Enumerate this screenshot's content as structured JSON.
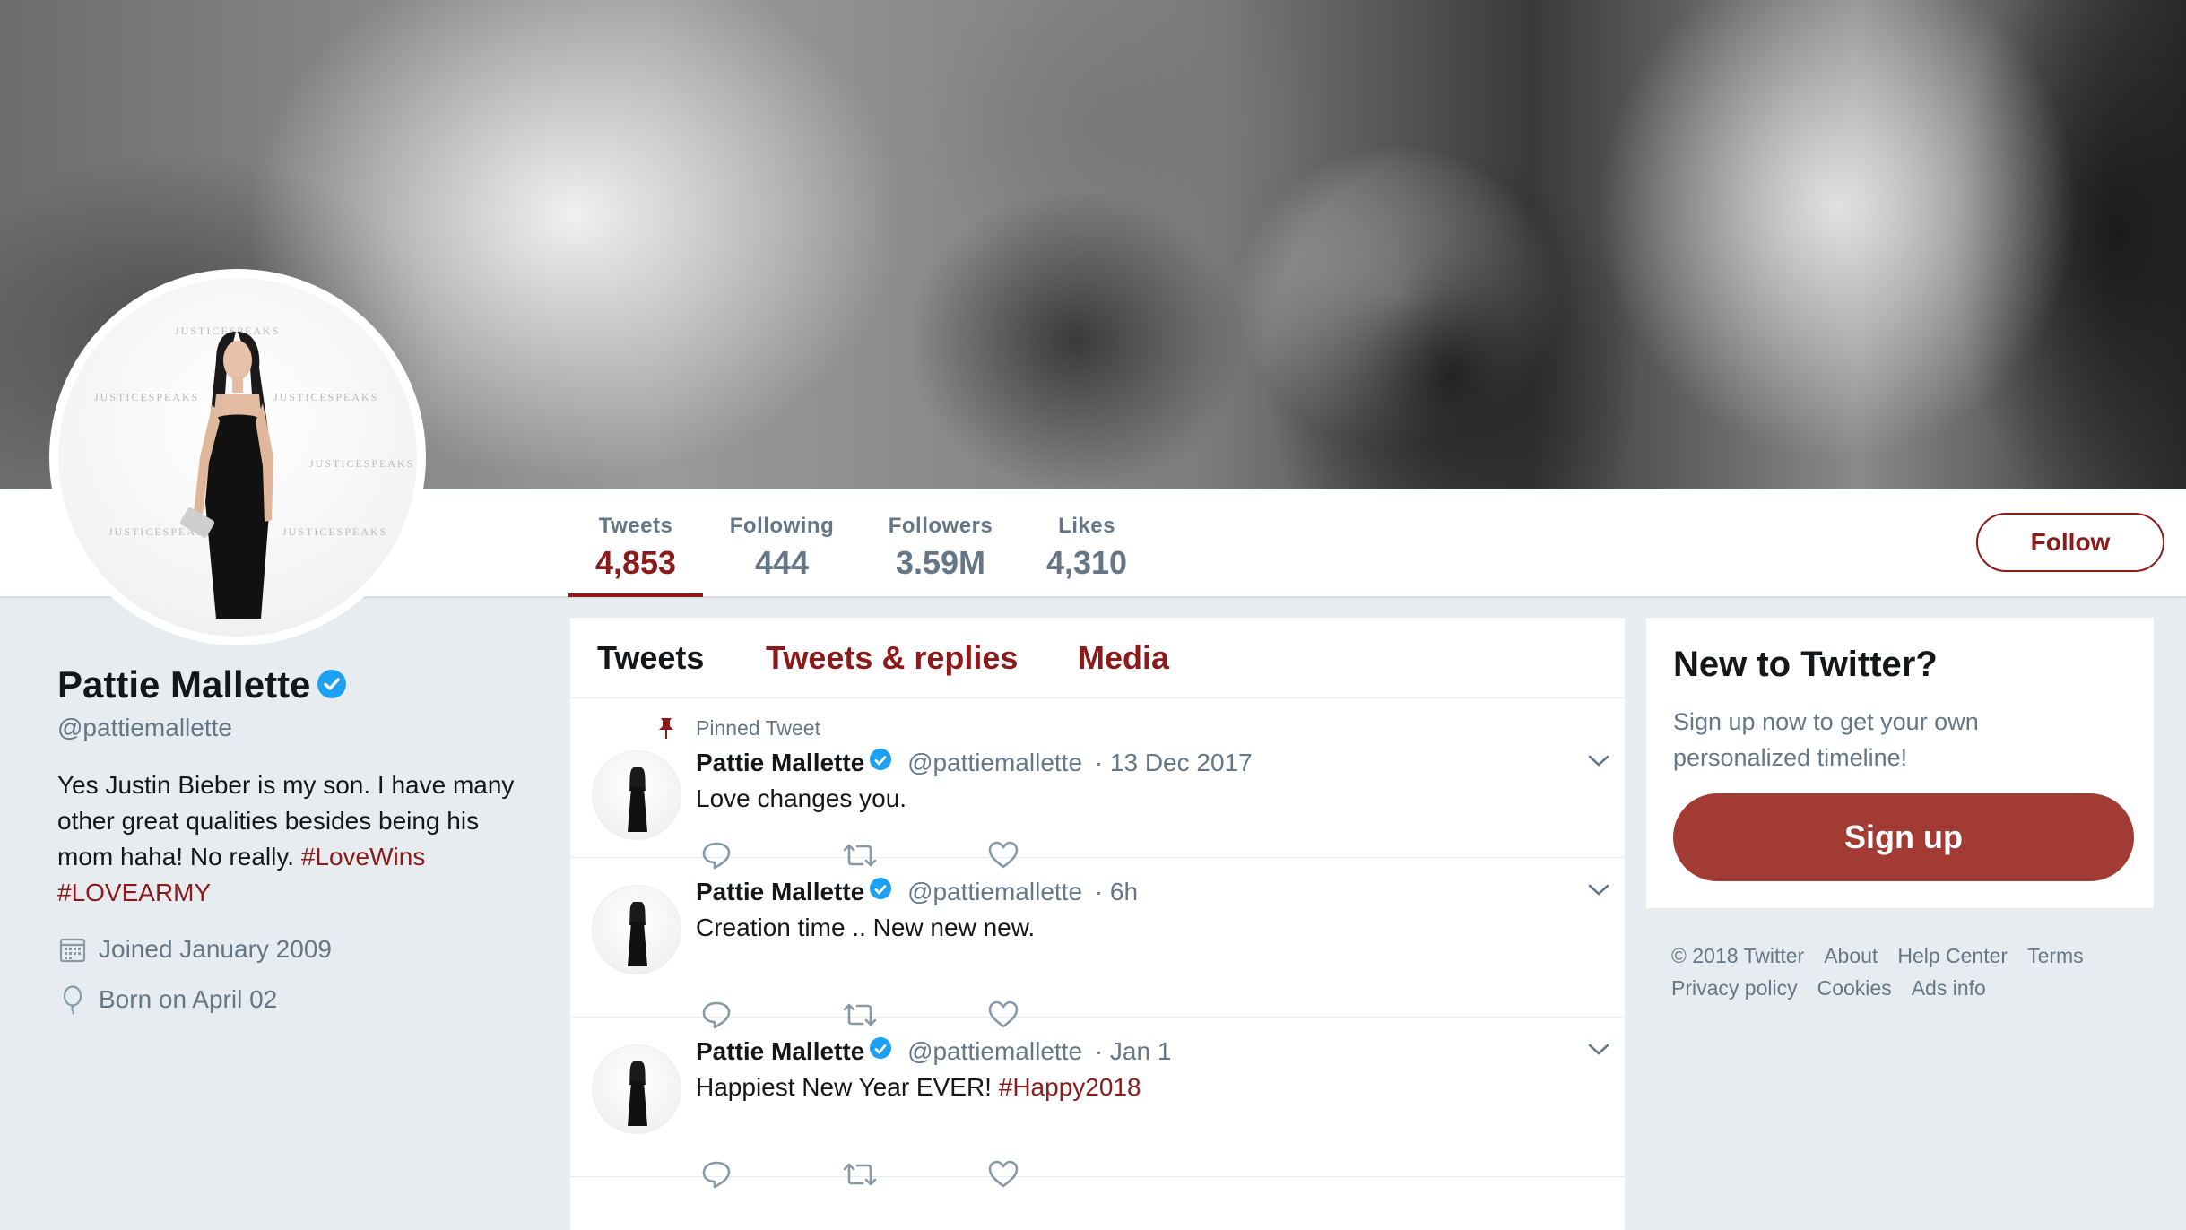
{
  "profile": {
    "name": "Pattie Mallette",
    "handle": "@pattiemallette",
    "bio_text": "Yes Justin Bieber is my son. I have many other great qualities besides being his mom haha! No really.",
    "bio_tag1": "#LoveWins",
    "bio_tag2": "#LOVEARMY",
    "joined": "Joined January 2009",
    "born": "Born on April 02",
    "avatar_watermark": "JUSTICESPEAKS"
  },
  "stats": [
    {
      "label": "Tweets",
      "value": "4,853"
    },
    {
      "label": "Following",
      "value": "444"
    },
    {
      "label": "Followers",
      "value": "3.59M"
    },
    {
      "label": "Likes",
      "value": "4,310"
    }
  ],
  "follow_label": "Follow",
  "tabs": [
    "Tweets",
    "Tweets & replies",
    "Media"
  ],
  "pinned_label": "Pinned Tweet",
  "tweets": [
    {
      "name": "Pattie Mallette",
      "handle": "@pattiemallette",
      "time": "· 13 Dec 2017",
      "text": "Love changes you.",
      "tag": ""
    },
    {
      "name": "Pattie Mallette",
      "handle": "@pattiemallette",
      "time": "· 6h",
      "text": "Creation time .. New new new.",
      "tag": ""
    },
    {
      "name": "Pattie Mallette",
      "handle": "@pattiemallette",
      "time": "· Jan 1",
      "text": "Happiest New Year EVER!",
      "tag": "#Happy2018"
    }
  ],
  "signup": {
    "title": "New to Twitter?",
    "subtitle": "Sign up now to get your own personalized timeline!",
    "button": "Sign up"
  },
  "footer": {
    "copyright": "© 2018 Twitter",
    "links": [
      "About",
      "Help Center",
      "Terms",
      "Privacy policy",
      "Cookies",
      "Ads info"
    ]
  },
  "colors": {
    "accent": "#8b1a1a",
    "signup_button": "#a33b35",
    "background": "#e6ecf0",
    "secondary_text": "#657786",
    "verified": "#1da1f2"
  },
  "icons": [
    "verified-badge-icon",
    "calendar-icon",
    "balloon-icon",
    "pin-icon",
    "chevron-down-icon",
    "reply-icon",
    "retweet-icon",
    "like-icon"
  ]
}
